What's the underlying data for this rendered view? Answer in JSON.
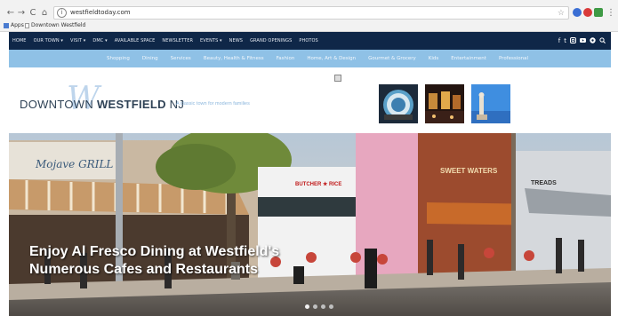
{
  "browser": {
    "url": "westfieldtoday.com",
    "bookmarks": [
      "Apps",
      "Downtown Westfield"
    ]
  },
  "topnav": {
    "items": [
      "HOME",
      "OUR TOWN ▾",
      "VISIT ▾",
      "DMC ▾",
      "AVAILABLE SPACE",
      "NEWSLETTER",
      "EVENTS ▾",
      "NEWS",
      "GRAND OPENINGS",
      "PHOTOS"
    ],
    "social_icons": [
      "f",
      "t",
      "i",
      "y",
      "s",
      "search"
    ]
  },
  "subnav": {
    "items": [
      "Shopping",
      "Dining",
      "Services",
      "Beauty, Health & Fitness",
      "Fashion",
      "Home, Art & Design",
      "Gourmet & Grocery",
      "Kids",
      "Entertainment",
      "Professional"
    ]
  },
  "header": {
    "logo_prefix": "DOWNTOWN ",
    "logo_bold": "WESTFIELD",
    "logo_suffix": " NJ",
    "logo_mark": "W",
    "tagline": "A classic town for modern families"
  },
  "hero": {
    "caption": "Enjoy Al Fresco Dining at Westfield's Numerous Cafes and Restaurants",
    "signs": [
      "Mojave GRILL",
      "BUTCHER ★ RICE",
      "SWEET WATERS",
      "TREADS"
    ],
    "slides": 4,
    "active_slide": 0
  },
  "colors": {
    "topnav_bg": "#0f2748",
    "subnav_bg": "#8fc1e6",
    "logo_text": "#2f4256",
    "tagline": "#8cb7dd"
  }
}
